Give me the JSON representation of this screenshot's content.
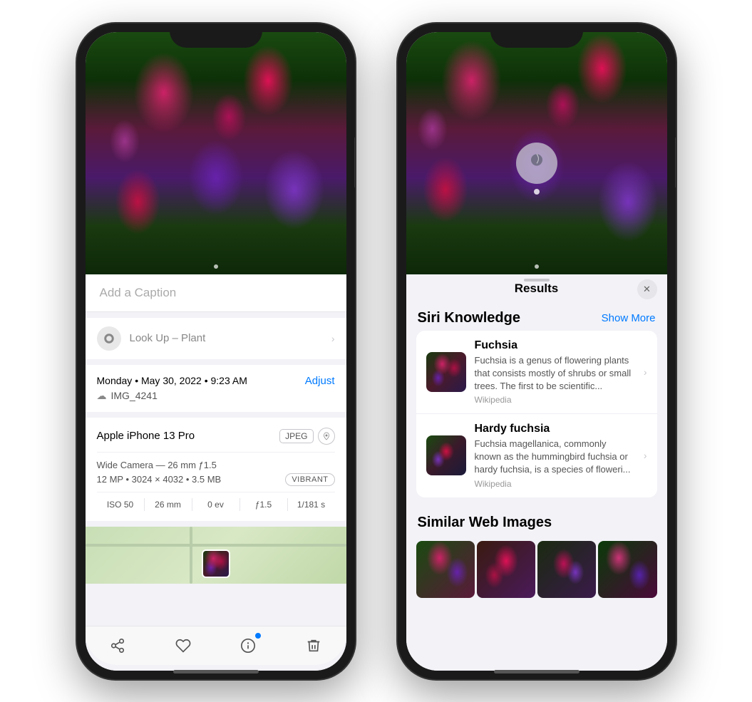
{
  "left_phone": {
    "caption_placeholder": "Add a Caption",
    "lookup_label": "Look Up –",
    "lookup_type": " Plant",
    "date": "Monday • May 30, 2022 • 9:23 AM",
    "adjust_label": "Adjust",
    "filename": "IMG_4241",
    "device": "Apple iPhone 13 Pro",
    "format_badge": "JPEG",
    "camera_spec1": "Wide Camera — 26 mm ƒ1.5",
    "camera_spec2": "12 MP • 3024 × 4032 • 3.5 MB",
    "vibrant_label": "VIBRANT",
    "exif": {
      "iso": "ISO 50",
      "mm": "26 mm",
      "ev": "0 ev",
      "aperture": "ƒ1.5",
      "shutter": "1/181 s"
    },
    "toolbar": {
      "share": "⬆",
      "like": "♡",
      "info": "ℹ",
      "delete": "🗑"
    }
  },
  "right_phone": {
    "results_title": "Results",
    "close_label": "✕",
    "siri_knowledge_title": "Siri Knowledge",
    "show_more_label": "Show More",
    "knowledge_items": [
      {
        "name": "Fuchsia",
        "desc": "Fuchsia is a genus of flowering plants that consists mostly of shrubs or small trees. The first to be scientific...",
        "source": "Wikipedia"
      },
      {
        "name": "Hardy fuchsia",
        "desc": "Fuchsia magellanica, commonly known as the hummingbird fuchsia or hardy fuchsia, is a species of floweri...",
        "source": "Wikipedia"
      }
    ],
    "similar_title": "Similar Web Images"
  }
}
